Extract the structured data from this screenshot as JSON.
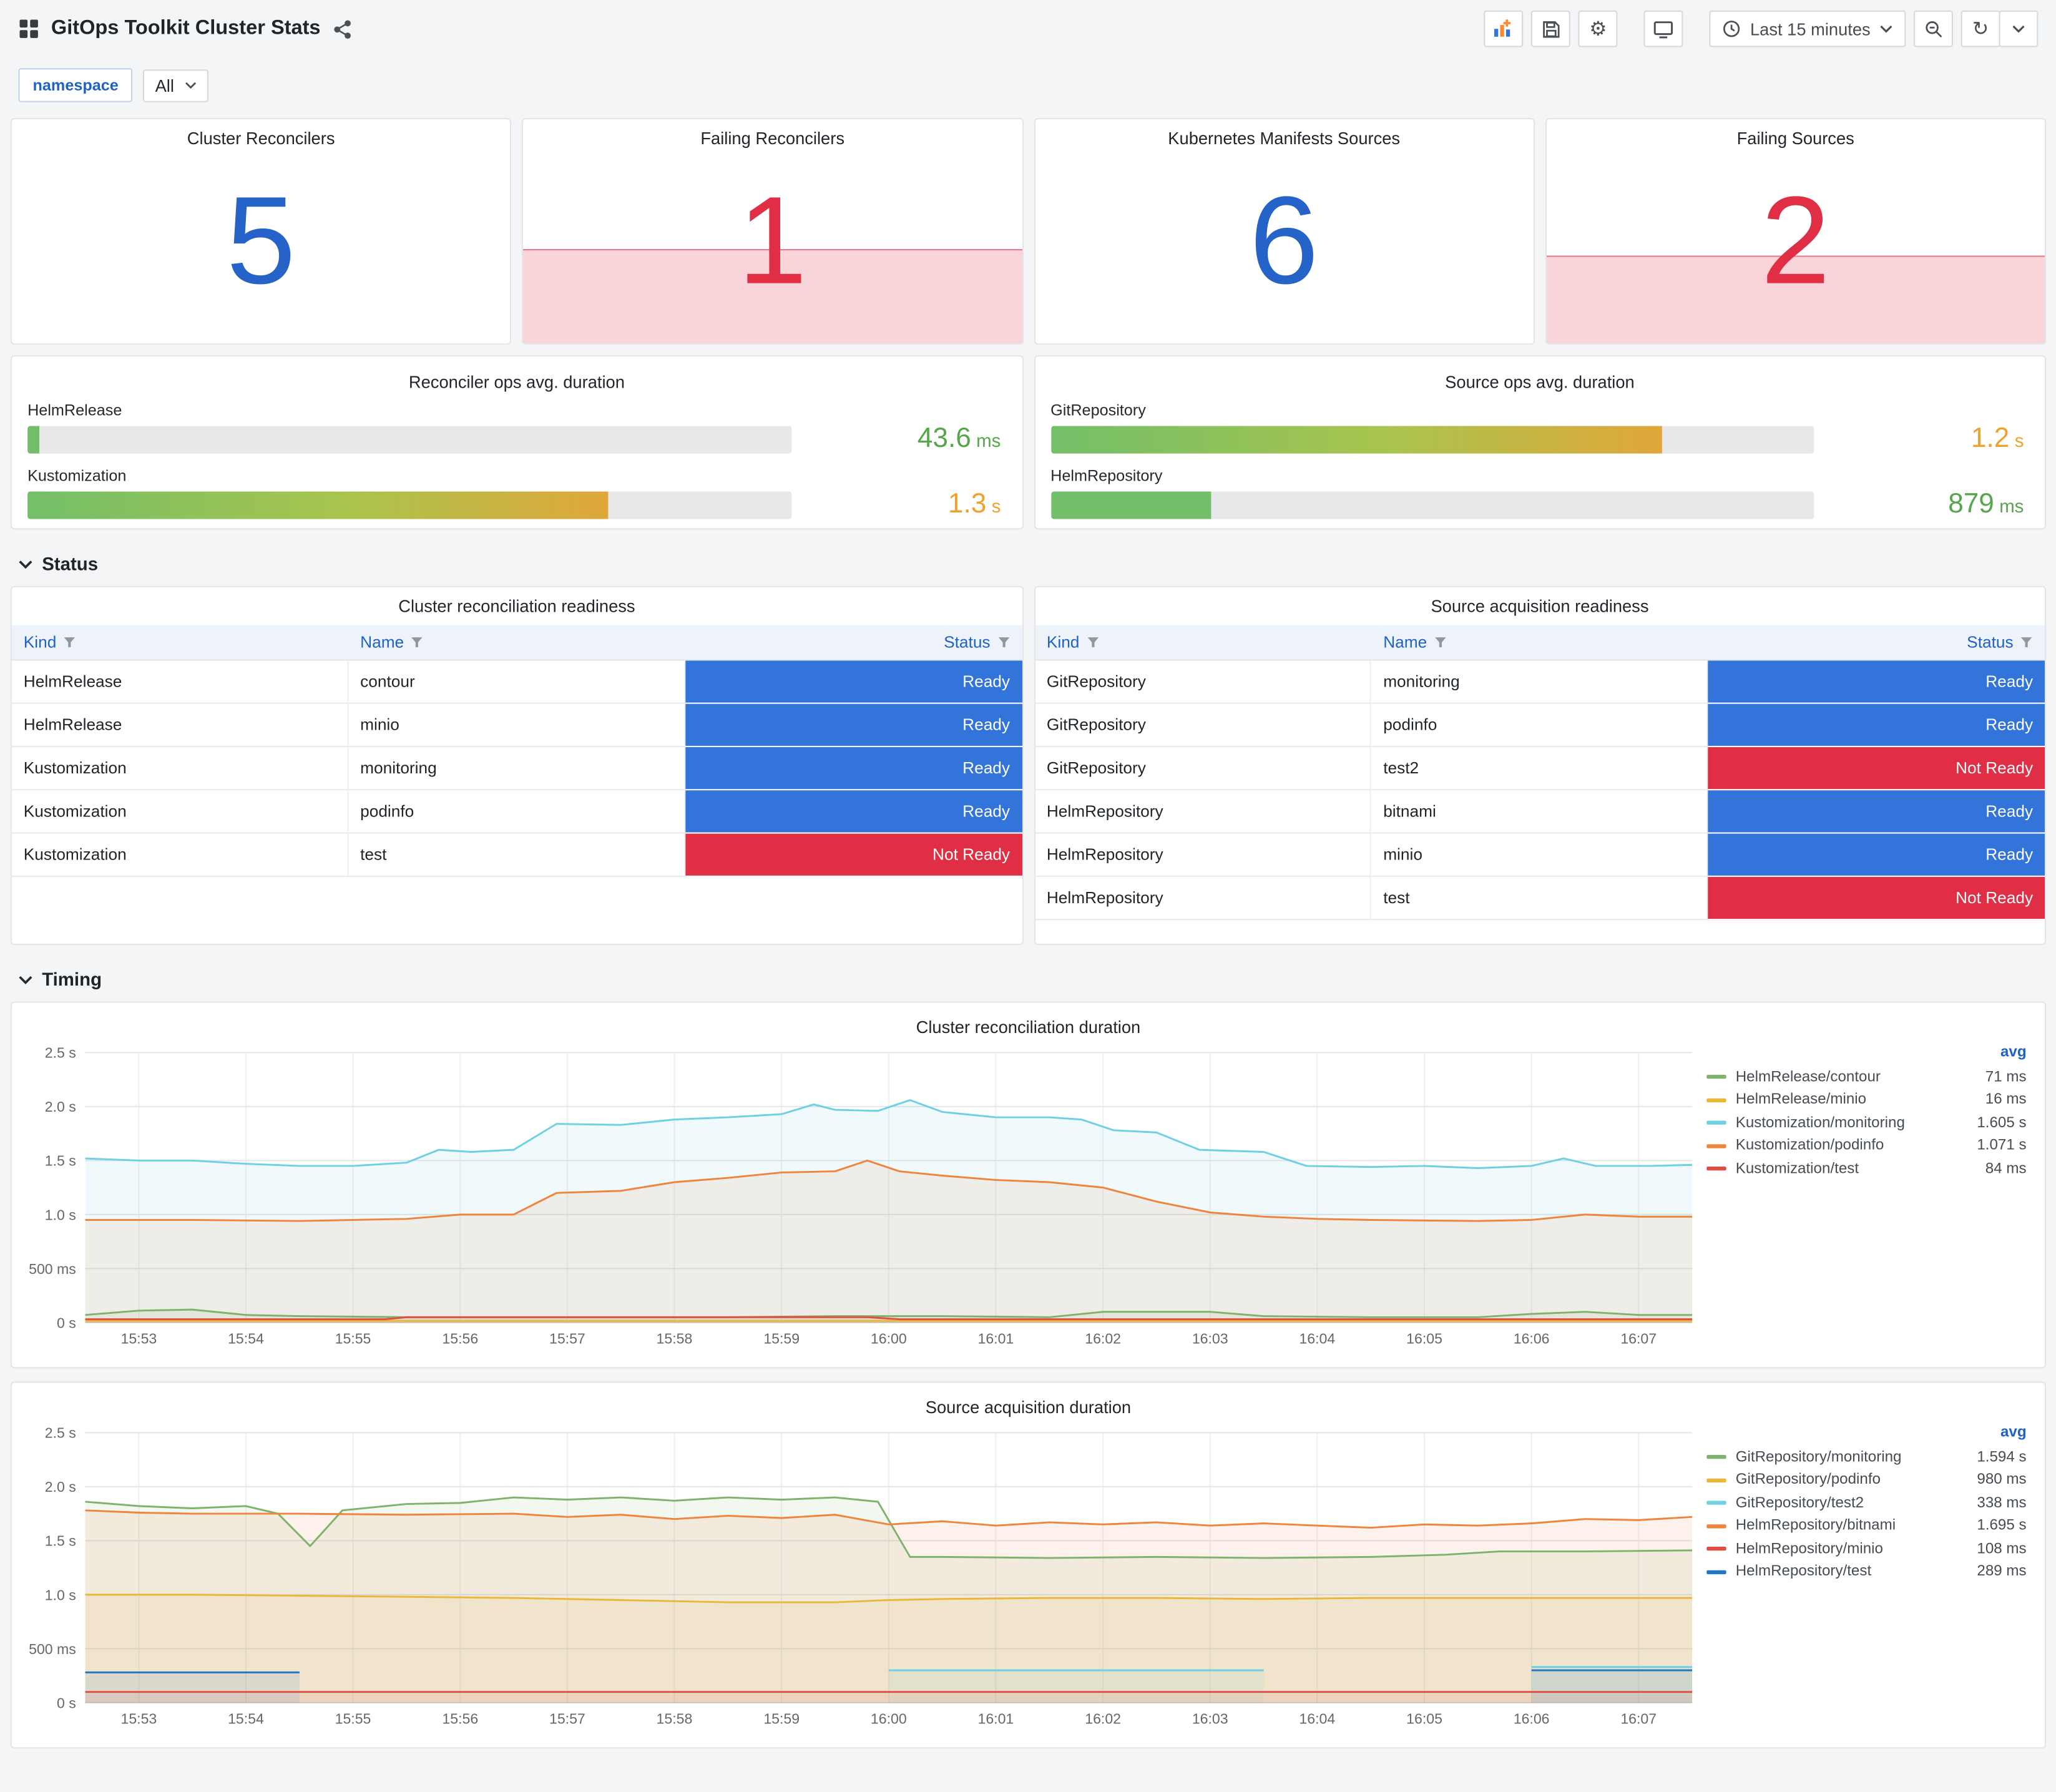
{
  "header": {
    "title": "GitOps Toolkit Cluster Stats",
    "time_range": "Last 15 minutes"
  },
  "icons": {
    "apps": "grid",
    "share": "share-nodes",
    "add_panel": "graph-plus",
    "save": "save",
    "settings_glyph": "⚙",
    "tv": "monitor",
    "clock": "clock",
    "zoom_out": "search-minus",
    "refresh_glyph": "↻",
    "caret": "angle-down",
    "filter": "funnel",
    "section_chevron": "angle-down"
  },
  "variables": {
    "label": "namespace",
    "value": "All"
  },
  "colors": {
    "stat_blue": "#2563c9",
    "stat_red": "#e02f44",
    "ready_bg": "#3274d9",
    "not_ready_bg": "#e02f44",
    "link_blue": "#1f62c4"
  },
  "stats": [
    {
      "title": "Cluster Reconcilers",
      "value": "5",
      "alert": false
    },
    {
      "title": "Failing Reconcilers",
      "value": "1",
      "alert": true
    },
    {
      "title": "Kubernetes Manifests Sources",
      "value": "6",
      "alert": false
    },
    {
      "title": "Failing Sources",
      "value": "2",
      "alert": true
    }
  ],
  "gauges": [
    {
      "title": "Reconciler ops avg. duration",
      "rows": [
        {
          "label": "HelmRelease",
          "value": "43.6",
          "unit": "ms",
          "pct": 1.5
        },
        {
          "label": "Kustomization",
          "value": "1.3",
          "unit": "s",
          "pct": 76
        }
      ]
    },
    {
      "title": "Source ops avg. duration",
      "rows": [
        {
          "label": "GitRepository",
          "value": "1.2",
          "unit": "s",
          "pct": 80
        },
        {
          "label": "HelmRepository",
          "value": "879",
          "unit": "ms",
          "pct": 21
        }
      ]
    }
  ],
  "sections": {
    "status": "Status",
    "timing": "Timing"
  },
  "tables": [
    {
      "title": "Cluster reconciliation readiness",
      "columns": [
        "Kind",
        "Name",
        "Status"
      ],
      "rows": [
        {
          "kind": "HelmRelease",
          "name": "contour",
          "status": "Ready"
        },
        {
          "kind": "HelmRelease",
          "name": "minio",
          "status": "Ready"
        },
        {
          "kind": "Kustomization",
          "name": "monitoring",
          "status": "Ready"
        },
        {
          "kind": "Kustomization",
          "name": "podinfo",
          "status": "Ready"
        },
        {
          "kind": "Kustomization",
          "name": "test",
          "status": "Not Ready"
        }
      ]
    },
    {
      "title": "Source acquisition readiness",
      "columns": [
        "Kind",
        "Name",
        "Status"
      ],
      "rows": [
        {
          "kind": "GitRepository",
          "name": "monitoring",
          "status": "Ready"
        },
        {
          "kind": "GitRepository",
          "name": "podinfo",
          "status": "Ready"
        },
        {
          "kind": "GitRepository",
          "name": "test2",
          "status": "Not Ready"
        },
        {
          "kind": "HelmRepository",
          "name": "bitnami",
          "status": "Ready"
        },
        {
          "kind": "HelmRepository",
          "name": "minio",
          "status": "Ready"
        },
        {
          "kind": "HelmRepository",
          "name": "test",
          "status": "Not Ready"
        }
      ]
    }
  ],
  "chart_data": [
    {
      "type": "line",
      "title": "Cluster reconciliation duration",
      "legend_header": "avg",
      "x_unit": "minutes since 15:52:30",
      "x_range": [
        0,
        15
      ],
      "ylim": [
        0,
        2.5
      ],
      "y_ticks": [
        {
          "v": 0,
          "label": "0 s"
        },
        {
          "v": 0.5,
          "label": "500 ms"
        },
        {
          "v": 1,
          "label": "1.0 s"
        },
        {
          "v": 1.5,
          "label": "1.5 s"
        },
        {
          "v": 2,
          "label": "2.0 s"
        },
        {
          "v": 2.5,
          "label": "2.5 s"
        }
      ],
      "x_ticks": [
        "15:53",
        "15:54",
        "15:55",
        "15:56",
        "15:57",
        "15:58",
        "15:59",
        "16:00",
        "16:01",
        "16:02",
        "16:03",
        "16:04",
        "16:05",
        "16:06",
        "16:07"
      ],
      "series": [
        {
          "name": "HelmRelease/contour",
          "avg": "71 ms",
          "color": "#7EB26D",
          "points": [
            [
              0,
              0.07
            ],
            [
              0.5,
              0.11
            ],
            [
              1,
              0.12
            ],
            [
              1.5,
              0.07
            ],
            [
              2,
              0.06
            ],
            [
              3,
              0.05
            ],
            [
              4,
              0.05
            ],
            [
              5,
              0.05
            ],
            [
              6,
              0.05
            ],
            [
              7,
              0.06
            ],
            [
              8,
              0.06
            ],
            [
              9,
              0.05
            ],
            [
              9.5,
              0.1
            ],
            [
              10.5,
              0.1
            ],
            [
              11,
              0.06
            ],
            [
              12,
              0.05
            ],
            [
              13,
              0.05
            ],
            [
              13.5,
              0.08
            ],
            [
              14,
              0.1
            ],
            [
              14.5,
              0.07
            ],
            [
              15,
              0.07
            ]
          ]
        },
        {
          "name": "HelmRelease/minio",
          "avg": "16 ms",
          "color": "#EAB839",
          "points": [
            [
              0,
              0.016
            ],
            [
              5,
              0.016
            ],
            [
              10,
              0.016
            ],
            [
              15,
              0.016
            ]
          ]
        },
        {
          "name": "Kustomization/monitoring",
          "avg": "1.605 s",
          "color": "#6ED0E0",
          "points": [
            [
              0,
              1.52
            ],
            [
              0.5,
              1.5
            ],
            [
              1,
              1.5
            ],
            [
              1.5,
              1.47
            ],
            [
              2,
              1.45
            ],
            [
              2.5,
              1.45
            ],
            [
              3,
              1.48
            ],
            [
              3.3,
              1.6
            ],
            [
              3.6,
              1.58
            ],
            [
              4,
              1.6
            ],
            [
              4.4,
              1.84
            ],
            [
              5,
              1.83
            ],
            [
              5.5,
              1.88
            ],
            [
              6,
              1.9
            ],
            [
              6.5,
              1.93
            ],
            [
              6.8,
              2.02
            ],
            [
              7,
              1.97
            ],
            [
              7.4,
              1.96
            ],
            [
              7.7,
              2.06
            ],
            [
              8,
              1.95
            ],
            [
              8.5,
              1.9
            ],
            [
              9,
              1.9
            ],
            [
              9.3,
              1.88
            ],
            [
              9.6,
              1.78
            ],
            [
              10,
              1.76
            ],
            [
              10.4,
              1.6
            ],
            [
              11,
              1.58
            ],
            [
              11.4,
              1.45
            ],
            [
              12,
              1.44
            ],
            [
              12.5,
              1.45
            ],
            [
              13,
              1.43
            ],
            [
              13.5,
              1.45
            ],
            [
              13.8,
              1.52
            ],
            [
              14.1,
              1.45
            ],
            [
              14.6,
              1.45
            ],
            [
              15,
              1.46
            ]
          ]
        },
        {
          "name": "Kustomization/podinfo",
          "avg": "1.071 s",
          "color": "#EF843C",
          "points": [
            [
              0,
              0.95
            ],
            [
              1,
              0.95
            ],
            [
              2,
              0.94
            ],
            [
              3,
              0.96
            ],
            [
              3.5,
              1.0
            ],
            [
              4,
              1.0
            ],
            [
              4.4,
              1.2
            ],
            [
              5,
              1.22
            ],
            [
              5.5,
              1.3
            ],
            [
              6,
              1.34
            ],
            [
              6.5,
              1.39
            ],
            [
              7,
              1.4
            ],
            [
              7.3,
              1.5
            ],
            [
              7.6,
              1.4
            ],
            [
              8,
              1.36
            ],
            [
              8.5,
              1.32
            ],
            [
              9,
              1.3
            ],
            [
              9.5,
              1.25
            ],
            [
              10,
              1.12
            ],
            [
              10.5,
              1.02
            ],
            [
              11,
              0.98
            ],
            [
              11.5,
              0.96
            ],
            [
              12,
              0.95
            ],
            [
              13,
              0.94
            ],
            [
              13.5,
              0.95
            ],
            [
              14,
              1.0
            ],
            [
              14.5,
              0.98
            ],
            [
              15,
              0.98
            ]
          ]
        },
        {
          "name": "Kustomization/test",
          "avg": "84 ms",
          "color": "#E24D42",
          "points": [
            [
              0,
              0.03
            ],
            [
              2.8,
              0.03
            ],
            [
              3,
              0.05
            ],
            [
              7.3,
              0.05
            ],
            [
              7.6,
              0.03
            ],
            [
              15,
              0.03
            ]
          ]
        }
      ]
    },
    {
      "type": "line",
      "title": "Source acquisition duration",
      "legend_header": "avg",
      "x_unit": "minutes since 15:52:30",
      "x_range": [
        0,
        15
      ],
      "ylim": [
        0,
        2.5
      ],
      "y_ticks": [
        {
          "v": 0,
          "label": "0 s"
        },
        {
          "v": 0.5,
          "label": "500 ms"
        },
        {
          "v": 1,
          "label": "1.0 s"
        },
        {
          "v": 1.5,
          "label": "1.5 s"
        },
        {
          "v": 2,
          "label": "2.0 s"
        },
        {
          "v": 2.5,
          "label": "2.5 s"
        }
      ],
      "x_ticks": [
        "15:53",
        "15:54",
        "15:55",
        "15:56",
        "15:57",
        "15:58",
        "15:59",
        "16:00",
        "16:01",
        "16:02",
        "16:03",
        "16:04",
        "16:05",
        "16:06",
        "16:07"
      ],
      "series": [
        {
          "name": "GitRepository/monitoring",
          "avg": "1.594 s",
          "color": "#7EB26D",
          "points": [
            [
              0,
              1.86
            ],
            [
              0.5,
              1.82
            ],
            [
              1,
              1.8
            ],
            [
              1.5,
              1.82
            ],
            [
              1.8,
              1.75
            ],
            [
              2.1,
              1.45
            ],
            [
              2.4,
              1.78
            ],
            [
              3,
              1.84
            ],
            [
              3.5,
              1.85
            ],
            [
              4,
              1.9
            ],
            [
              4.5,
              1.88
            ],
            [
              5,
              1.9
            ],
            [
              5.5,
              1.87
            ],
            [
              6,
              1.9
            ],
            [
              6.5,
              1.88
            ],
            [
              7,
              1.9
            ],
            [
              7.4,
              1.86
            ],
            [
              7.7,
              1.35
            ],
            [
              8,
              1.35
            ],
            [
              9,
              1.34
            ],
            [
              10,
              1.35
            ],
            [
              11,
              1.34
            ],
            [
              12,
              1.35
            ],
            [
              12.7,
              1.37
            ],
            [
              13.2,
              1.4
            ],
            [
              14,
              1.4
            ],
            [
              15,
              1.41
            ]
          ]
        },
        {
          "name": "GitRepository/podinfo",
          "avg": "980 ms",
          "color": "#EAB839",
          "points": [
            [
              0,
              1.0
            ],
            [
              1,
              1.0
            ],
            [
              2,
              0.99
            ],
            [
              3,
              0.98
            ],
            [
              4,
              0.97
            ],
            [
              5,
              0.95
            ],
            [
              6,
              0.93
            ],
            [
              7,
              0.93
            ],
            [
              7.5,
              0.95
            ],
            [
              8,
              0.96
            ],
            [
              9,
              0.97
            ],
            [
              10,
              0.97
            ],
            [
              11,
              0.96
            ],
            [
              12,
              0.97
            ],
            [
              13,
              0.97
            ],
            [
              14,
              0.97
            ],
            [
              15,
              0.97
            ]
          ]
        },
        {
          "name": "GitRepository/test2",
          "avg": "338 ms",
          "color": "#6ED0E0",
          "points": [
            [
              7.5,
              0.3
            ],
            [
              9,
              0.3
            ],
            [
              10.5,
              0.3
            ],
            [
              11,
              0.3
            ],
            null,
            [
              13.5,
              0.33
            ],
            [
              14.5,
              0.33
            ],
            [
              15,
              0.33
            ]
          ]
        },
        {
          "name": "HelmRepository/bitnami",
          "avg": "1.695 s",
          "color": "#EF843C",
          "points": [
            [
              0,
              1.78
            ],
            [
              0.5,
              1.76
            ],
            [
              1,
              1.75
            ],
            [
              2,
              1.75
            ],
            [
              3,
              1.74
            ],
            [
              4,
              1.75
            ],
            [
              4.5,
              1.72
            ],
            [
              5,
              1.74
            ],
            [
              5.5,
              1.7
            ],
            [
              6,
              1.73
            ],
            [
              6.5,
              1.71
            ],
            [
              7,
              1.74
            ],
            [
              7.5,
              1.65
            ],
            [
              8,
              1.68
            ],
            [
              8.5,
              1.64
            ],
            [
              9,
              1.67
            ],
            [
              9.5,
              1.65
            ],
            [
              10,
              1.67
            ],
            [
              10.5,
              1.64
            ],
            [
              11,
              1.66
            ],
            [
              11.5,
              1.64
            ],
            [
              12,
              1.62
            ],
            [
              12.5,
              1.65
            ],
            [
              13,
              1.64
            ],
            [
              13.5,
              1.66
            ],
            [
              14,
              1.7
            ],
            [
              14.5,
              1.69
            ],
            [
              15,
              1.72
            ]
          ]
        },
        {
          "name": "HelmRepository/minio",
          "avg": "108 ms",
          "color": "#E24D42",
          "points": [
            [
              0,
              0.1
            ],
            [
              5,
              0.1
            ],
            [
              10,
              0.1
            ],
            [
              15,
              0.1
            ]
          ]
        },
        {
          "name": "HelmRepository/test",
          "avg": "289 ms",
          "color": "#1F78C1",
          "points": [
            [
              0,
              0.28
            ],
            [
              1,
              0.28
            ],
            [
              2,
              0.28
            ],
            null,
            [
              13.5,
              0.3
            ],
            [
              14.5,
              0.3
            ],
            [
              15,
              0.3
            ]
          ]
        }
      ]
    }
  ]
}
